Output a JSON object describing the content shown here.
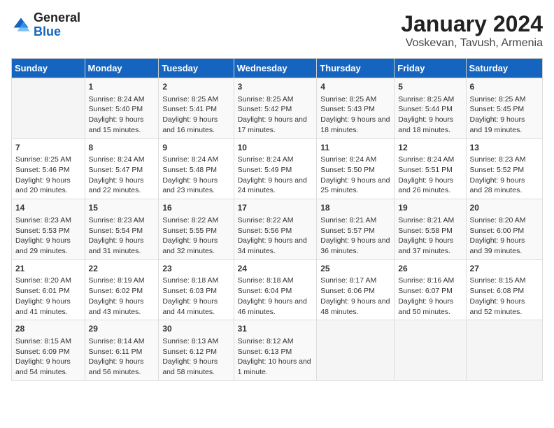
{
  "header": {
    "logo_general": "General",
    "logo_blue": "Blue",
    "main_title": "January 2024",
    "sub_title": "Voskevan, Tavush, Armenia"
  },
  "days_of_week": [
    "Sunday",
    "Monday",
    "Tuesday",
    "Wednesday",
    "Thursday",
    "Friday",
    "Saturday"
  ],
  "weeks": [
    [
      {
        "day": "",
        "sunrise": "",
        "sunset": "",
        "daylight": ""
      },
      {
        "day": "1",
        "sunrise": "Sunrise: 8:24 AM",
        "sunset": "Sunset: 5:40 PM",
        "daylight": "Daylight: 9 hours and 15 minutes."
      },
      {
        "day": "2",
        "sunrise": "Sunrise: 8:25 AM",
        "sunset": "Sunset: 5:41 PM",
        "daylight": "Daylight: 9 hours and 16 minutes."
      },
      {
        "day": "3",
        "sunrise": "Sunrise: 8:25 AM",
        "sunset": "Sunset: 5:42 PM",
        "daylight": "Daylight: 9 hours and 17 minutes."
      },
      {
        "day": "4",
        "sunrise": "Sunrise: 8:25 AM",
        "sunset": "Sunset: 5:43 PM",
        "daylight": "Daylight: 9 hours and 18 minutes."
      },
      {
        "day": "5",
        "sunrise": "Sunrise: 8:25 AM",
        "sunset": "Sunset: 5:44 PM",
        "daylight": "Daylight: 9 hours and 18 minutes."
      },
      {
        "day": "6",
        "sunrise": "Sunrise: 8:25 AM",
        "sunset": "Sunset: 5:45 PM",
        "daylight": "Daylight: 9 hours and 19 minutes."
      }
    ],
    [
      {
        "day": "7",
        "sunrise": "Sunrise: 8:25 AM",
        "sunset": "Sunset: 5:46 PM",
        "daylight": "Daylight: 9 hours and 20 minutes."
      },
      {
        "day": "8",
        "sunrise": "Sunrise: 8:24 AM",
        "sunset": "Sunset: 5:47 PM",
        "daylight": "Daylight: 9 hours and 22 minutes."
      },
      {
        "day": "9",
        "sunrise": "Sunrise: 8:24 AM",
        "sunset": "Sunset: 5:48 PM",
        "daylight": "Daylight: 9 hours and 23 minutes."
      },
      {
        "day": "10",
        "sunrise": "Sunrise: 8:24 AM",
        "sunset": "Sunset: 5:49 PM",
        "daylight": "Daylight: 9 hours and 24 minutes."
      },
      {
        "day": "11",
        "sunrise": "Sunrise: 8:24 AM",
        "sunset": "Sunset: 5:50 PM",
        "daylight": "Daylight: 9 hours and 25 minutes."
      },
      {
        "day": "12",
        "sunrise": "Sunrise: 8:24 AM",
        "sunset": "Sunset: 5:51 PM",
        "daylight": "Daylight: 9 hours and 26 minutes."
      },
      {
        "day": "13",
        "sunrise": "Sunrise: 8:23 AM",
        "sunset": "Sunset: 5:52 PM",
        "daylight": "Daylight: 9 hours and 28 minutes."
      }
    ],
    [
      {
        "day": "14",
        "sunrise": "Sunrise: 8:23 AM",
        "sunset": "Sunset: 5:53 PM",
        "daylight": "Daylight: 9 hours and 29 minutes."
      },
      {
        "day": "15",
        "sunrise": "Sunrise: 8:23 AM",
        "sunset": "Sunset: 5:54 PM",
        "daylight": "Daylight: 9 hours and 31 minutes."
      },
      {
        "day": "16",
        "sunrise": "Sunrise: 8:22 AM",
        "sunset": "Sunset: 5:55 PM",
        "daylight": "Daylight: 9 hours and 32 minutes."
      },
      {
        "day": "17",
        "sunrise": "Sunrise: 8:22 AM",
        "sunset": "Sunset: 5:56 PM",
        "daylight": "Daylight: 9 hours and 34 minutes."
      },
      {
        "day": "18",
        "sunrise": "Sunrise: 8:21 AM",
        "sunset": "Sunset: 5:57 PM",
        "daylight": "Daylight: 9 hours and 36 minutes."
      },
      {
        "day": "19",
        "sunrise": "Sunrise: 8:21 AM",
        "sunset": "Sunset: 5:58 PM",
        "daylight": "Daylight: 9 hours and 37 minutes."
      },
      {
        "day": "20",
        "sunrise": "Sunrise: 8:20 AM",
        "sunset": "Sunset: 6:00 PM",
        "daylight": "Daylight: 9 hours and 39 minutes."
      }
    ],
    [
      {
        "day": "21",
        "sunrise": "Sunrise: 8:20 AM",
        "sunset": "Sunset: 6:01 PM",
        "daylight": "Daylight: 9 hours and 41 minutes."
      },
      {
        "day": "22",
        "sunrise": "Sunrise: 8:19 AM",
        "sunset": "Sunset: 6:02 PM",
        "daylight": "Daylight: 9 hours and 43 minutes."
      },
      {
        "day": "23",
        "sunrise": "Sunrise: 8:18 AM",
        "sunset": "Sunset: 6:03 PM",
        "daylight": "Daylight: 9 hours and 44 minutes."
      },
      {
        "day": "24",
        "sunrise": "Sunrise: 8:18 AM",
        "sunset": "Sunset: 6:04 PM",
        "daylight": "Daylight: 9 hours and 46 minutes."
      },
      {
        "day": "25",
        "sunrise": "Sunrise: 8:17 AM",
        "sunset": "Sunset: 6:06 PM",
        "daylight": "Daylight: 9 hours and 48 minutes."
      },
      {
        "day": "26",
        "sunrise": "Sunrise: 8:16 AM",
        "sunset": "Sunset: 6:07 PM",
        "daylight": "Daylight: 9 hours and 50 minutes."
      },
      {
        "day": "27",
        "sunrise": "Sunrise: 8:15 AM",
        "sunset": "Sunset: 6:08 PM",
        "daylight": "Daylight: 9 hours and 52 minutes."
      }
    ],
    [
      {
        "day": "28",
        "sunrise": "Sunrise: 8:15 AM",
        "sunset": "Sunset: 6:09 PM",
        "daylight": "Daylight: 9 hours and 54 minutes."
      },
      {
        "day": "29",
        "sunrise": "Sunrise: 8:14 AM",
        "sunset": "Sunset: 6:11 PM",
        "daylight": "Daylight: 9 hours and 56 minutes."
      },
      {
        "day": "30",
        "sunrise": "Sunrise: 8:13 AM",
        "sunset": "Sunset: 6:12 PM",
        "daylight": "Daylight: 9 hours and 58 minutes."
      },
      {
        "day": "31",
        "sunrise": "Sunrise: 8:12 AM",
        "sunset": "Sunset: 6:13 PM",
        "daylight": "Daylight: 10 hours and 1 minute."
      },
      {
        "day": "",
        "sunrise": "",
        "sunset": "",
        "daylight": ""
      },
      {
        "day": "",
        "sunrise": "",
        "sunset": "",
        "daylight": ""
      },
      {
        "day": "",
        "sunrise": "",
        "sunset": "",
        "daylight": ""
      }
    ]
  ]
}
